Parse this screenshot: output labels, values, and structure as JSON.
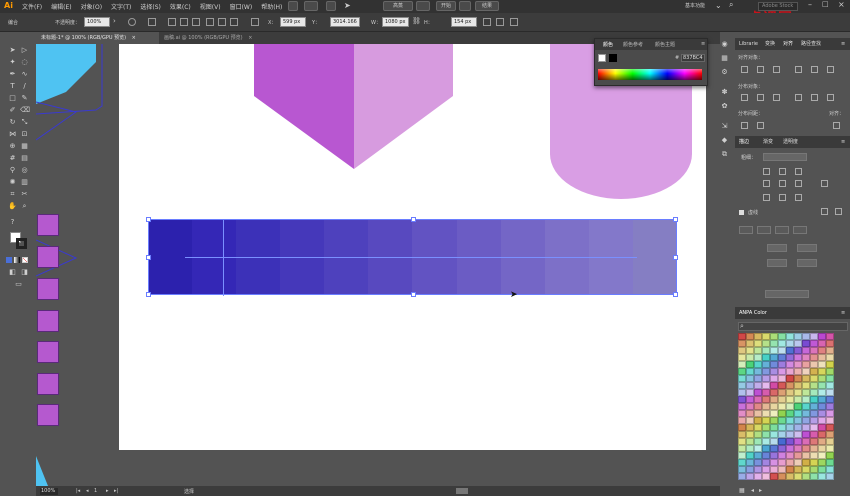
{
  "app": {
    "logo": "Ai"
  },
  "menu": [
    "文件(F)",
    "编辑(E)",
    "对象(O)",
    "文字(T)",
    "选择(S)",
    "效果(C)",
    "视图(V)",
    "窗口(W)",
    "帮助(H)"
  ],
  "top_buttons": [
    "高蒸",
    "开始",
    "结果"
  ],
  "workspace": "基本功能",
  "search_placeholder": "Adobe Stock",
  "watermark": "虎课网",
  "control": {
    "group_label": "编合",
    "opacity_label": "不透明度：",
    "opacity_value": "100%",
    "x_label": "X：",
    "x_value": "599 px",
    "y_label": "Y：",
    "y_value": "3014.166",
    "w_label": "W：",
    "w_value": "1080 px",
    "h_label": "H：",
    "h_value": "154 px"
  },
  "tabs": [
    {
      "label": "未标题-1* @ 100% (RGB/GPU 预览)",
      "active": true
    },
    {
      "label": "画稿.ai @ 100% (RGB/GPU 预览)",
      "active": false
    }
  ],
  "status": {
    "zoom": "100%",
    "page": "1",
    "tool": "选择"
  },
  "color_panel": {
    "tabs": [
      "颜色",
      "颜色参考",
      "颜色主题"
    ],
    "hex": "837BC4",
    "hash": "#"
  },
  "right_panels": {
    "top_tabs": [
      "Librarie",
      "变换",
      "对齐",
      "路径查找"
    ],
    "align_objects": "对齐对象：",
    "distribute_objects": "分布对象：",
    "distribute_spacing": "分布间距：",
    "align_to": "对齐：",
    "stroke_tabs": [
      "描边",
      "渐变",
      "透明度"
    ],
    "weight_label": "粗细：",
    "dashed_label": "虚线",
    "anpa_title": "ANPA Color",
    "anpa_search_icon": "search-icon"
  },
  "gradient_bar": {
    "colors": [
      "#2c21ad",
      "#3427b6",
      "#3c31b8",
      "#4538ba",
      "#4e41bd",
      "#5849bf",
      "#6253c2",
      "#6b5cc4",
      "#7466c6",
      "#7d70c8",
      "#8378ca",
      "#857ec3"
    ]
  },
  "shapes": {
    "cube_left": "#b857d1",
    "cube_right": "#d79bdf",
    "cube_top": "#ecdaf3",
    "cylinder": "#d99ee4",
    "left_squares": "#b559cf",
    "left_blue": "#4fc3f2",
    "outline": "#3a3ad0"
  }
}
